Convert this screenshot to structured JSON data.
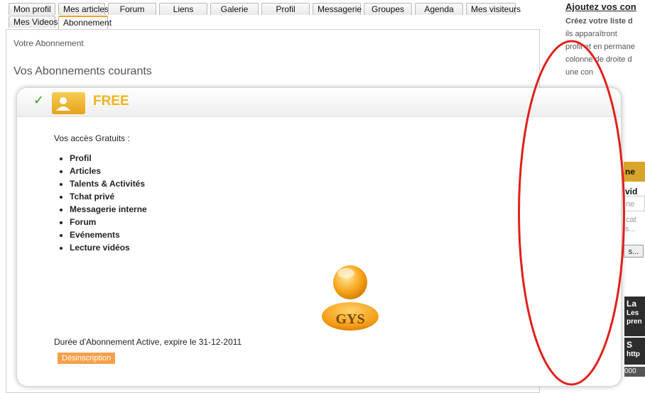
{
  "tabs_row1": [
    "Mon profil",
    "Mes articles",
    "Forum",
    "Liens",
    "Galerie",
    "Profil",
    "Messagerie",
    "Groupes",
    "Agenda",
    "Mes visiteurs"
  ],
  "tabs_row2": [
    "Mes Videos",
    "Abonnement"
  ],
  "active_tab": "Abonnement",
  "breadcrumb": "Votre Abonnement",
  "page_title": "Vos Abonnements courants",
  "plan": {
    "name": "FREE",
    "access_title": "Vos accès Gratuits :",
    "access_items": [
      "Profil",
      "Articles",
      "Talents & Activités",
      "Tchat privé",
      "Messagerie interne",
      "Forum",
      "Evénements",
      "Lecture vidéos"
    ],
    "logo_text": "GYS",
    "expiry_text": "Durée d'Abonnement Active, expire le 31-12-2011",
    "unsubscribe_label": "Désinscription"
  },
  "right_column": {
    "title": "Ajoutez vos con",
    "subtitle": "Créez votre liste d",
    "lines": [
      "ils apparaîtront",
      "profil et en permane",
      "colonne de droite d",
      "une            con"
    ],
    "bar_text": "ne vid",
    "input_placeholder": "ne cat",
    "input2_text": "s...",
    "button_text": "s...",
    "dark_block1": {
      "title": "La",
      "line1": "Les",
      "line2": "pren"
    },
    "dark_block2": {
      "title": "S",
      "line1": "http"
    },
    "strip_text": "000"
  },
  "colors": {
    "accent": "#f0b41e",
    "active_tab_border": "#f0a020",
    "unsubscribe_bg": "#f7a04b",
    "annotation_oval": "#e0201a",
    "check": "#3a9a2e"
  }
}
